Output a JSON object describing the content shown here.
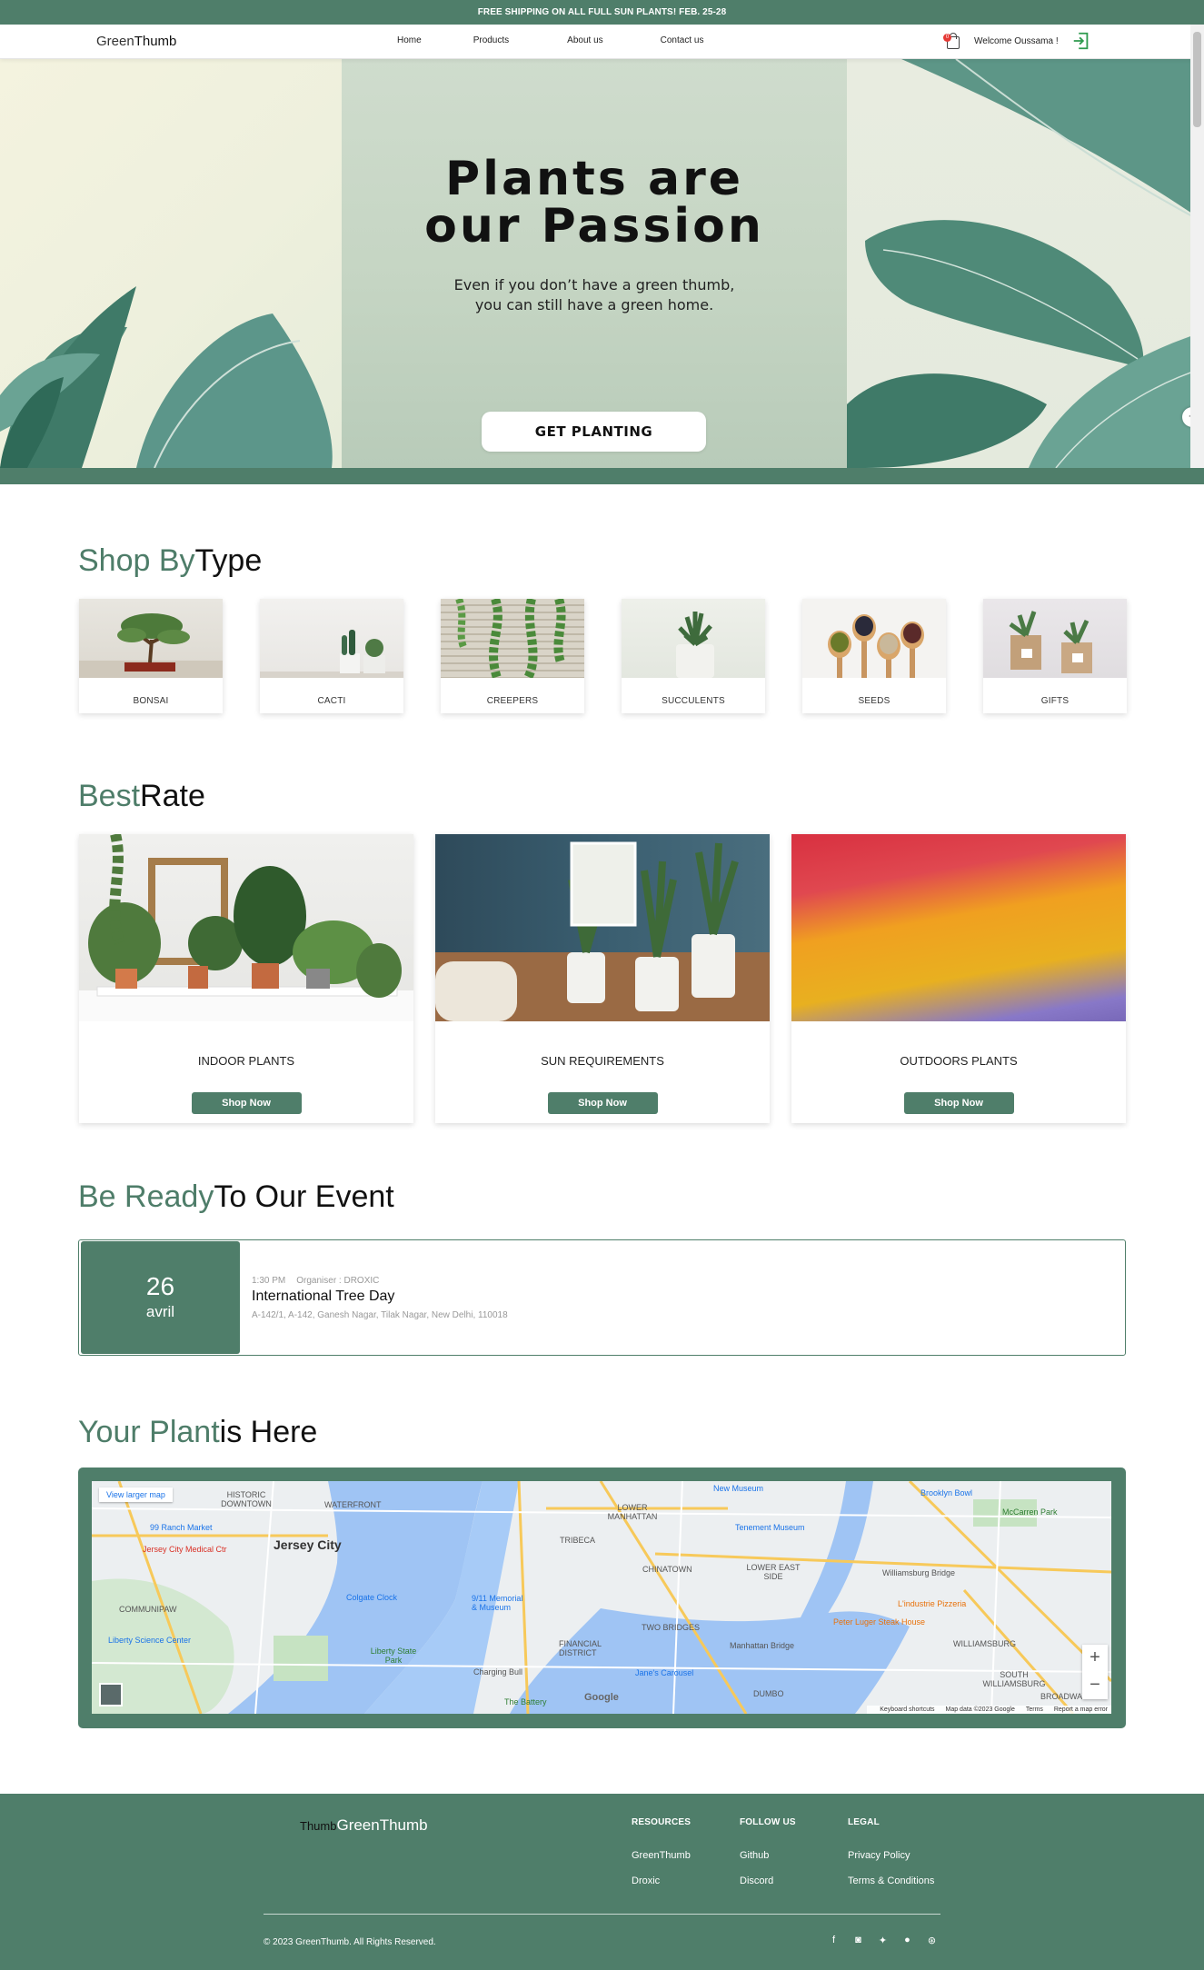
{
  "promo": {
    "text": "FREE SHIPPING ON ALL FULL SUN PLANTS! FEB. 25-28"
  },
  "nav": {
    "logo_a": "Green",
    "logo_b": "Thumb",
    "links": [
      "Home",
      "Products",
      "About us",
      "Contact us"
    ],
    "cart_count": "0",
    "welcome": "Welcome Oussama !"
  },
  "hero": {
    "title_line1": "Plants are",
    "title_line2": "our Passion",
    "subtitle_line1": "Even if you don’t have a green thumb,",
    "subtitle_line2": "you can still have a green home.",
    "cta": "GET PLANTING"
  },
  "shop_type": {
    "title_a": "Shop By",
    "title_b": "Type",
    "items": [
      "BONSAI",
      "CACTI",
      "CREEPERS",
      "SUCCULENTS",
      "SEEDS",
      "GIFTS"
    ]
  },
  "best_rate": {
    "title_a": "Best",
    "title_b": "Rate",
    "items": [
      "INDOOR PLANTS",
      "SUN REQUIREMENTS",
      "OUTDOORS PLANTS"
    ],
    "button": "Shop Now"
  },
  "event": {
    "title_a": "Be Ready",
    "title_b": "To Our Event",
    "day": "26",
    "month": "avril",
    "time": "1:30 PM",
    "organiser": "Organiser : DROXIC",
    "name": "International Tree Day",
    "address": "A-142/1, A-142, Ganesh Nagar, Tilak Nagar, New Delhi, 110018"
  },
  "map": {
    "title_a": "Your Plant",
    "title_b": "is Here",
    "link": "View larger map",
    "labels": [
      "Jersey City",
      "LOWER MANHATTAN",
      "TRIBECA",
      "CHINATOWN",
      "LOWER EAST SIDE",
      "FINANCIAL DISTRICT",
      "TWO BRIDGES",
      "DUMBO",
      "WILLIAMSBURG",
      "SOUTH WILLIAMSBURG",
      "COMMUNIPAW",
      "Liberty Science Center",
      "Liberty State Park",
      "HISTORIC DOWNTOWN",
      "WATERFRONT",
      "Williamsburg Bridge",
      "Manhattan Bridge",
      "New Museum",
      "Tenement Museum",
      "Brooklyn Bowl",
      "McCarren Park",
      "99 Ranch Market",
      "Jersey City Medical Ctr",
      "Colgate Clock",
      "9/11 Memorial & Museum",
      "The Battery",
      "Jane's Carousel",
      "Peter Luger Steak House",
      "L'industrie Pizzeria",
      "Charging Bull",
      "BROADWAY"
    ],
    "footer": [
      "Keyboard shortcuts",
      "Map data ©2023 Google",
      "Terms",
      "Report a map error"
    ],
    "zoom_in": "+",
    "zoom_out": "−",
    "google": "Google"
  },
  "footer": {
    "brand_thin": "Thumb",
    "brand": "GreenThumb",
    "columns": [
      {
        "title": "RESOURCES",
        "links": [
          "GreenThumb",
          "Droxic"
        ]
      },
      {
        "title": "FOLLOW US",
        "links": [
          "Github",
          "Discord"
        ]
      },
      {
        "title": "LEGAL",
        "links": [
          "Privacy Policy",
          "Terms & Conditions"
        ]
      }
    ],
    "copyright": "© 2023 GreenThumb. All Rights Reserved.",
    "socials": [
      "facebook-icon",
      "discord-icon",
      "twitter-icon",
      "github-icon",
      "dribbble-icon"
    ]
  },
  "colors": {
    "brand": "#4f7e6a",
    "accent_text": "#4e7d69"
  }
}
